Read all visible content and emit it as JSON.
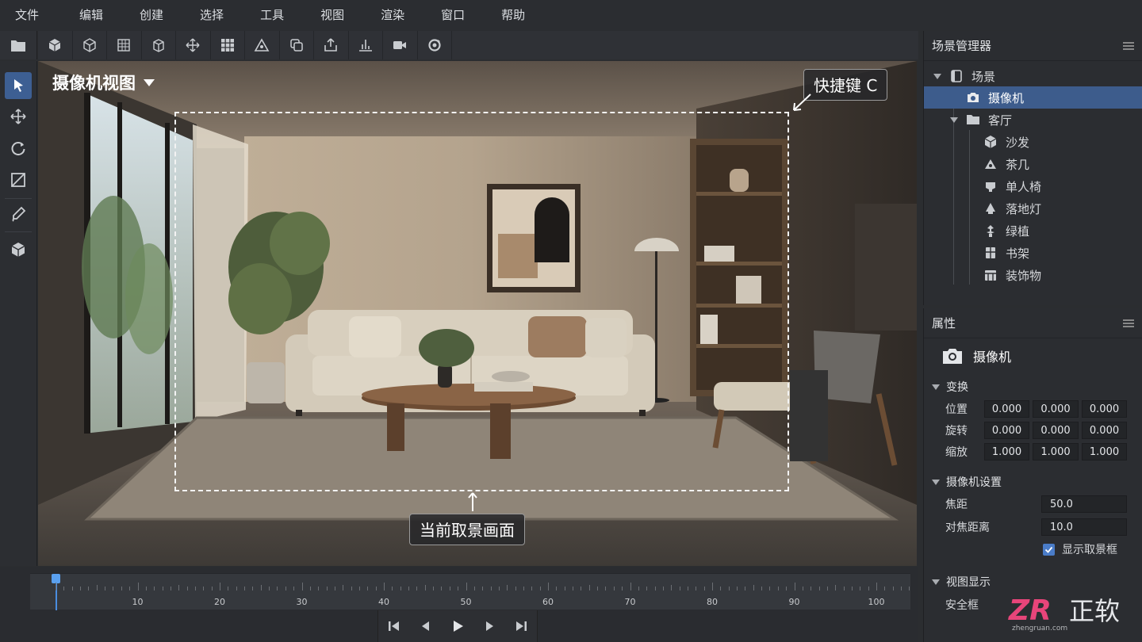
{
  "menu": [
    "文件",
    "编辑",
    "创建",
    "选择",
    "工具",
    "视图",
    "渲染",
    "窗口",
    "帮助"
  ],
  "toolbar_icons": [
    "folder-icon",
    "cube-solid-icon",
    "cube-wire-icon",
    "grid-cube-icon",
    "box-edge-icon",
    "move-axis-icon",
    "grid-icon",
    "terrain-icon",
    "duplicate-icon",
    "export-icon",
    "align-icon",
    "video-camera-icon",
    "refresh-render-icon"
  ],
  "tools": [
    "select-arrow-icon",
    "move-icon",
    "rotate-icon",
    "scale-icon",
    "paint-icon",
    "object-icon"
  ],
  "viewport": {
    "title": "摄像机视图",
    "shortcut_callout": "快捷键 C",
    "frame_callout": "当前取景画面"
  },
  "timeline": {
    "labels": [
      "10",
      "20",
      "30",
      "40",
      "50",
      "60",
      "70",
      "80",
      "90",
      "100"
    ],
    "playhead_frame": 0
  },
  "transport_icons": [
    "skip-start-icon",
    "prev-frame-icon",
    "play-icon",
    "next-frame-icon",
    "skip-end-icon"
  ],
  "scene_manager": {
    "title": "场景管理器",
    "root": "场景",
    "camera": "摄像机",
    "group": "客厅",
    "items": [
      "沙发",
      "茶几",
      "单人椅",
      "落地灯",
      "绿植",
      "书架",
      "装饰物"
    ]
  },
  "properties": {
    "title": "属性",
    "object_name": "摄像机",
    "transform_title": "变换",
    "position_label": "位置",
    "rotation_label": "旋转",
    "scale_label": "缩放",
    "position": [
      "0.000",
      "0.000",
      "0.000"
    ],
    "rotation": [
      "0.000",
      "0.000",
      "0.000"
    ],
    "scale": [
      "1.000",
      "1.000",
      "1.000"
    ],
    "camera_settings_title": "摄像机设置",
    "focal_label": "焦距",
    "focal_value": "50.0",
    "focus_dist_label": "对焦距离",
    "focus_dist_value": "10.0",
    "show_frame_label": "显示取景框",
    "show_frame_checked": true,
    "view_display_title": "视图显示",
    "safe_frame_label": "安全框"
  },
  "watermark": {
    "logo": "ZR",
    "text": "正软",
    "url": "zhengruan.com"
  },
  "colors": {
    "accent": "#3d5c8c",
    "active_tool": "#3d5f93",
    "playhead": "#4a8de0",
    "watermark_pink": "#e8457a"
  }
}
